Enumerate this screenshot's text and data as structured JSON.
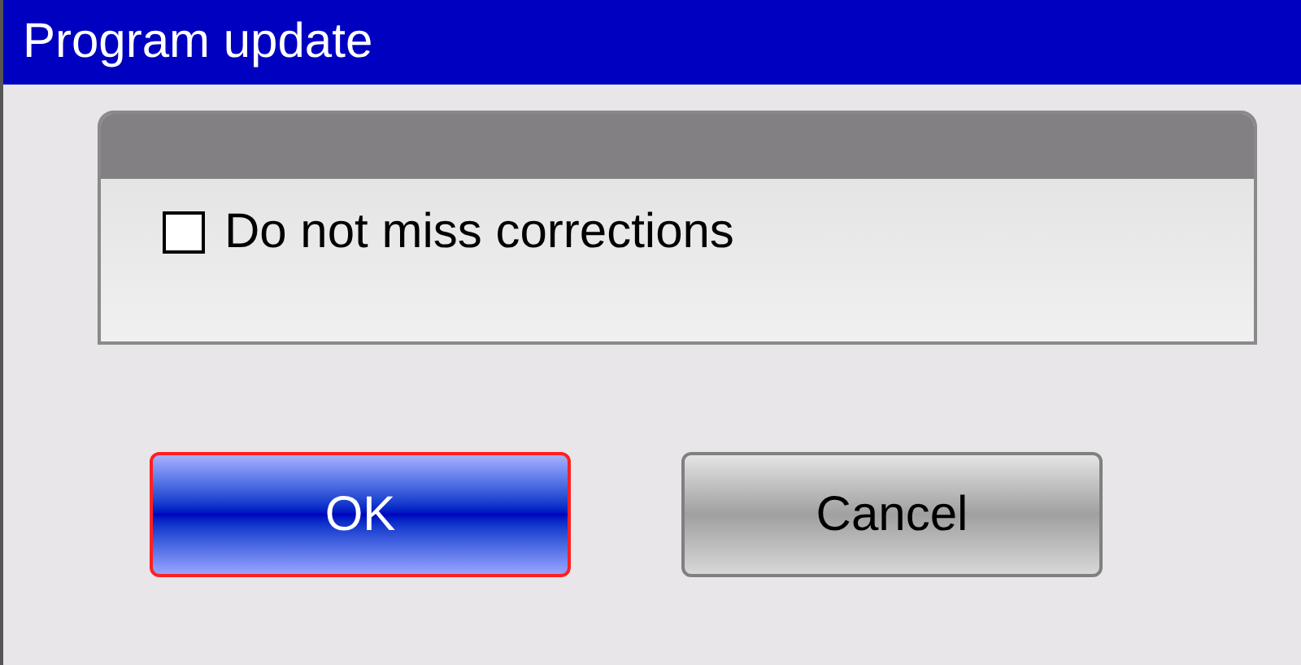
{
  "window": {
    "title": "Program update"
  },
  "options": [
    {
      "label": "Do not miss corrections",
      "checked": false
    }
  ],
  "buttons": [
    {
      "label": "OK",
      "selected": true
    },
    {
      "label": "Cancel",
      "selected": false
    }
  ]
}
